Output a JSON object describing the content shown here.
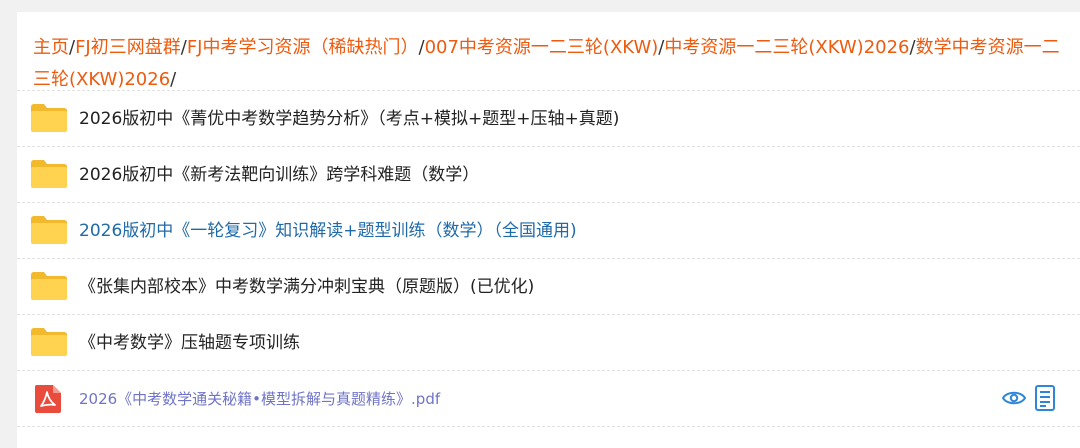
{
  "breadcrumb": {
    "items": [
      {
        "label": "主页"
      },
      {
        "label": "FJ初三网盘群"
      },
      {
        "label": "FJ中考学习资源（稀缺热门）"
      },
      {
        "label": "007中考资源一二三轮(XKW)"
      },
      {
        "label": "中考资源一二三轮(XKW)2026"
      },
      {
        "label": "数学中考资源一二三轮(XKW)2026"
      }
    ],
    "separator": "/"
  },
  "folders": [
    {
      "label": "2026版初中《菁优中考数学趋势分析》（考点+模拟+题型+压轴+真题)",
      "icon": "folder-icon"
    },
    {
      "label": "2026版初中《新考法靶向训练》跨学科难题（数学）",
      "icon": "folder-icon"
    },
    {
      "label": "2026版初中《一轮复习》知识解读+题型训练（数学）（全国通用)",
      "icon": "folder-icon"
    },
    {
      "label": "《张集内部校本》中考数学满分冲刺宝典（原题版）(已优化)",
      "icon": "folder-icon"
    },
    {
      "label": "《中考数学》压轴题专项训练",
      "icon": "folder-icon"
    }
  ],
  "file": {
    "label": "2026《中考数学通关秘籍•模型拆解与真题精练》.pdf",
    "icon": "pdf-icon",
    "actions": [
      "eye-icon",
      "document-icon"
    ]
  },
  "colors": {
    "breadcrumb_link": "#ee5a0e",
    "active_folder_text": "#1f6aa8",
    "file_text": "#6f74c6",
    "folder_yellow": "#ffd34f",
    "pdf_red": "#e94b3c",
    "action_blue": "#2f86d8"
  }
}
